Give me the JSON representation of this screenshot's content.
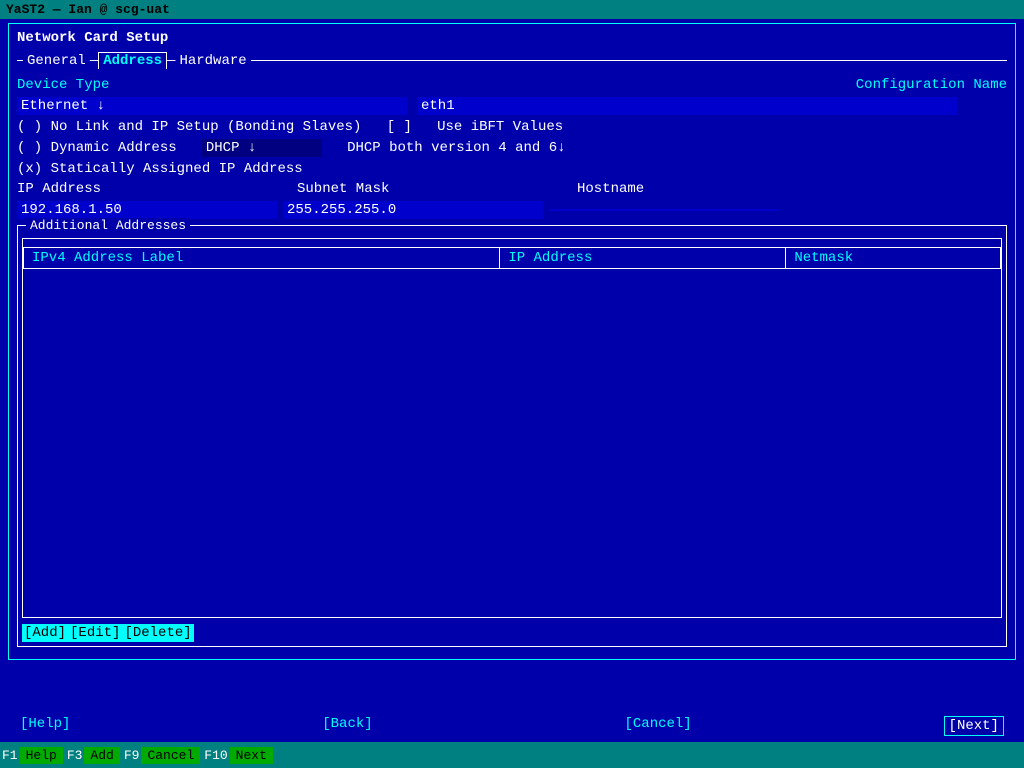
{
  "titlebar": {
    "text": "YaST2 — Ian @ scg-uat"
  },
  "app_title": "Network Card Setup",
  "tabs": {
    "items": [
      "General",
      "Address",
      "Hardware"
    ]
  },
  "form": {
    "device_type_label": "Device Type",
    "config_name_label": "Configuration Name",
    "device_value": "Ethernet",
    "device_dropdown": "↓",
    "config_value": "eth1",
    "radio_no_link": "( ) No Link and IP Setup (Bonding Slaves)",
    "radio_no_link_checkbox": "[ ]",
    "radio_no_link_use": "Use iBFT Values",
    "radio_dynamic": "( ) Dynamic Address",
    "dhcp_value": "DHCP",
    "dhcp_dropdown": "↓",
    "dhcp_desc": "DHCP both version 4 and 6",
    "dhcp_desc_arrow": "↓",
    "radio_static": "(x) Statically Assigned IP Address",
    "ip_label": "IP Address",
    "subnet_label": "Subnet Mask",
    "hostname_label": "Hostname",
    "ip_value": "192.168.1.50",
    "subnet_value": "255.255.255.0",
    "hostname_value": ""
  },
  "additional_addresses": {
    "label": "Additional Addresses",
    "table_headers": [
      "IPv4 Address Label",
      "IP Address",
      "Netmask"
    ],
    "rows": []
  },
  "box_buttons": {
    "add": "[Add]",
    "edit": "[Edit]",
    "delete": "[Delete]"
  },
  "action_bar": {
    "help": "[Help]",
    "back": "[Back]",
    "cancel": "[Cancel]",
    "next": "[Next]"
  },
  "fkeys": {
    "f1_num": "F1",
    "f1_label": "Help",
    "f3_num": "F3",
    "f3_label": "Add",
    "f9_num": "F9",
    "f9_label": "Cancel",
    "f10_num": "F10",
    "f10_label": "Next"
  },
  "colors": {
    "bg": "#0000aa",
    "titlebar_bg": "#008080",
    "active_input_bg": "#0000cc",
    "fkey_bar_bg": "#008080",
    "fkey_label_bg": "#00aa00"
  }
}
